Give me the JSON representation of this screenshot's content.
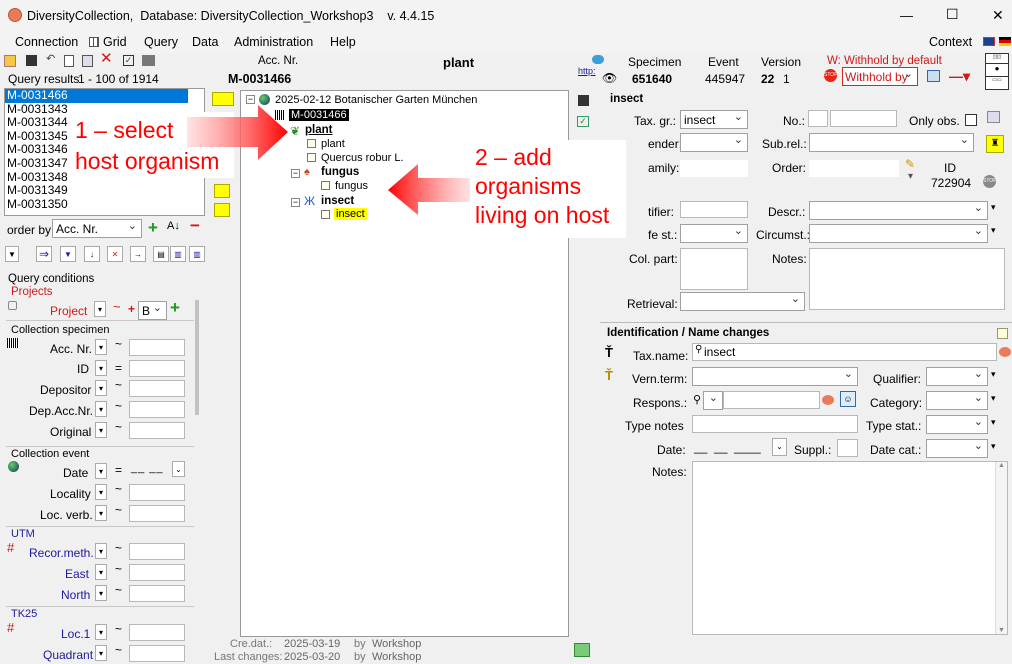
{
  "window": {
    "title": "DiversityCollection,  Database: DiversityCollection_Workshop3    v. 4.4.15",
    "minimize": "—",
    "maximize": "☐",
    "close": "✕"
  },
  "menu": {
    "connection": "Connection",
    "grid": "Grid",
    "query": "Query",
    "data": "Data",
    "administration": "Administration",
    "help": "Help",
    "context": "Context"
  },
  "query": {
    "results_label": "Query results",
    "results_range": "1 - 100 of 1914",
    "items": [
      "M-0031466",
      "M-0031343",
      "M-0031344",
      "M-0031345",
      "M-0031346",
      "M-0031347",
      "M-0031348",
      "M-0031349",
      "M-0031350"
    ],
    "order_label": "order by:",
    "order_value": "Acc. Nr.",
    "conditions_label": "Query conditions"
  },
  "conditions": {
    "projects_header": "Projects",
    "project_label": "Project",
    "project_value": "B",
    "plus": "+",
    "tilde": "~",
    "collection_specimen_header": "Collection specimen",
    "acc_nr": "Acc. Nr.",
    "id": "ID",
    "depositor": "Depositor",
    "dep_acc_nr": "Dep.Acc.Nr.",
    "original": "Original",
    "collection_event_header": "Collection event",
    "date": "Date",
    "date_value": "__ __",
    "locality": "Locality",
    "loc_verb": "Loc. verb.",
    "utm_header": "UTM",
    "recor_meth": "Recor.meth.",
    "east": "East",
    "north": "North",
    "tk25_header": "TK25",
    "loc1": "Loc.1",
    "quadrant": "Quadrant",
    "eq": "="
  },
  "header": {
    "acc_nr_label": "Acc. Nr.",
    "acc_nr_value": "M-0031466",
    "organism_title": "plant",
    "http": "http:",
    "specimen_label": "Specimen",
    "specimen_value": "651640",
    "event_label": "Event",
    "event_value": "445947",
    "version_label": "Version",
    "version_value": "22",
    "version_sub": "1",
    "withhold_label": "W: Withhold by default",
    "withhold_value": "Withhold by"
  },
  "tree": {
    "event": "2025-02-12 Botanischer Garten München",
    "specimen": "M-0031466",
    "plant": "plant",
    "plant_part": "plant",
    "quercus": "Quercus robur L.",
    "fungus": "fungus",
    "fungus_part": "fungus",
    "insect": "insect",
    "insect_part": "insect",
    "cre_dat_label": "Cre.dat.:",
    "cre_dat_value": "2025-03-19",
    "by_label": "by",
    "cre_by": "Workshop",
    "last_changes_label": "Last changes:",
    "last_changes_value": "2025-03-20",
    "last_by": "Workshop"
  },
  "detail": {
    "unit_title": "insect",
    "tax_gr_label": "Tax. gr.:",
    "tax_gr_value": "insect",
    "no_label": "No.:",
    "only_obs_label": "Only obs.",
    "gender_label": "ender:",
    "sub_rel_label": "Sub.rel.:",
    "family_label": "amily:",
    "order_label": "Order:",
    "id_label": "ID",
    "id_value": "722904",
    "identifier_label": "tifier:",
    "descr_label": "Descr.:",
    "life_st_label": "fe st.:",
    "circumst_label": "Circumst.:",
    "col_part_label": "Col. part:",
    "notes_label": "Notes:",
    "retrieval_label": "Retrieval:"
  },
  "ident": {
    "title": "Identification / Name changes",
    "tax_name_label": "Tax.name:",
    "tax_name_value": "insect",
    "vern_term_label": "Vern.term:",
    "qualifier_label": "Qualifier:",
    "respons_label": "Respons.:",
    "category_label": "Category:",
    "type_notes_label": "Type notes",
    "type_stat_label": "Type stat.:",
    "date_label": "Date:",
    "date_value": "__  __  ____",
    "suppl_label": "Suppl.:",
    "date_cat_label": "Date cat.:",
    "notes_label": "Notes:"
  },
  "annotations": {
    "step1_line1": "1 – select",
    "step1_line2": "host organism",
    "step2_line1": "2 – add",
    "step2_line2": "organisms",
    "step2_line3": "living on host"
  },
  "colors": {
    "accent": "#0078d7",
    "highlight": "#ffff00",
    "annotation_red": "#ff0000",
    "selected_bg": "#0078d7"
  }
}
